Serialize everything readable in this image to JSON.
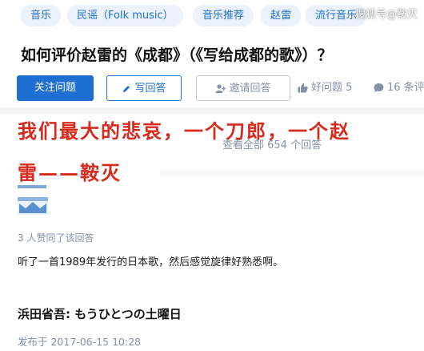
{
  "topics": [
    "音乐",
    "民谣（Folk music）",
    "音乐推荐",
    "赵雷",
    "流行音乐"
  ],
  "watermark": "搜狐号@鞍灭",
  "question_title": "如何评价赵雷的《成都》（《写给成都的歌》）？",
  "actions": {
    "follow": "关注问题",
    "write_answer": "写回答",
    "invite": "邀请回答",
    "good_question": "好问题 5",
    "comments": "16 条评"
  },
  "overlay": {
    "line1": "我们最大的悲哀，一个刀郎，一个赵",
    "line2": "雷——鞍灭"
  },
  "view_all": "查看全部 654 个回答",
  "answer": {
    "upvote_meta": "3 人赞同了该回答",
    "text": "听了一首1989年发行的日本歌，然后感觉旋律好熟悉啊。",
    "song": "浜田省吾: もうひとつの土曜日",
    "published": "发布于 2017-06-15 10:28"
  },
  "colors": {
    "brand_blue": "#1e6fd1",
    "overlay_red": "#d52a1d",
    "muted_gray": "#8590a6"
  }
}
